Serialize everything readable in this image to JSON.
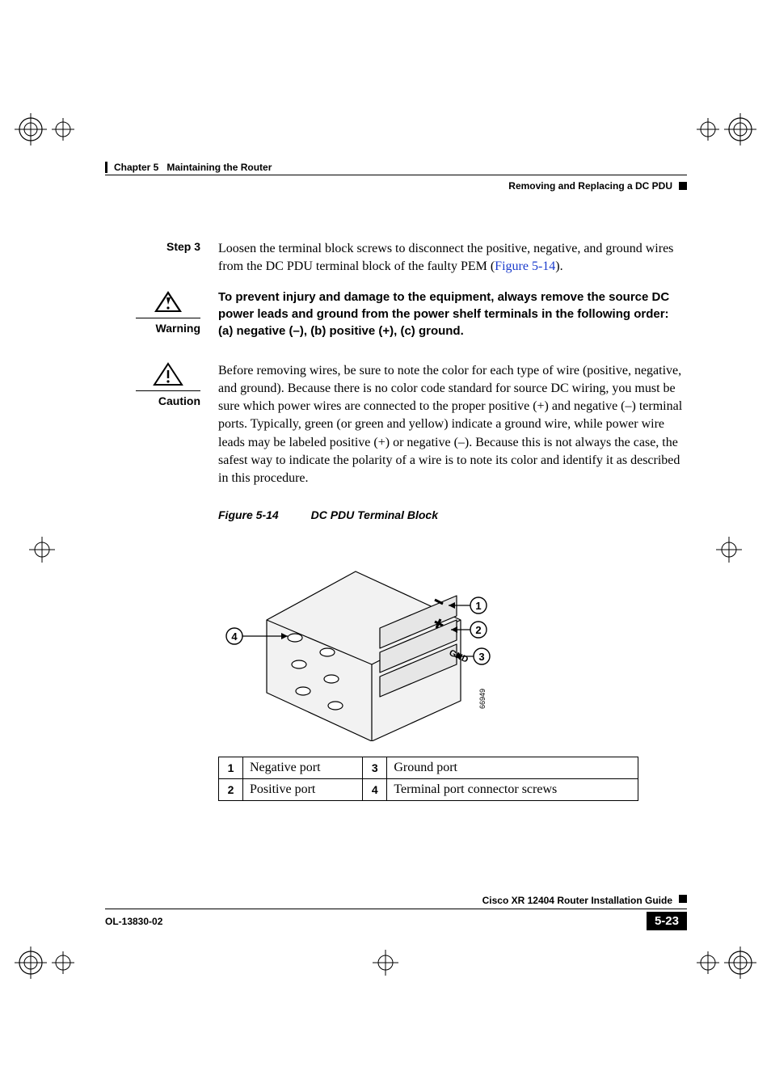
{
  "header": {
    "chapter": "Chapter 5",
    "chapter_title": "Maintaining the Router",
    "section": "Removing and Replacing a DC PDU"
  },
  "step": {
    "label": "Step 3",
    "text_a": "Loosen the terminal block screws to disconnect the positive, negative, and ground wires from the DC PDU terminal block of the faulty PEM (",
    "link": "Figure 5-14",
    "text_b": ")."
  },
  "warning": {
    "label": "Warning",
    "text": "To prevent injury and damage to the equipment, always remove the source DC power leads and ground from the power shelf terminals in the following order: (a) negative (–), (b) positive (+), (c) ground."
  },
  "caution": {
    "label": "Caution",
    "text": "Before removing wires, be sure to note the color for each type of wire (positive, negative, and ground). Because there is no color code standard for source DC wiring, you must be sure which power wires are connected to the proper positive (+) and negative (–) terminal ports. Typically, green (or green and yellow) indicate a ground wire, while power wire leads may be labeled positive (+) or negative (–). Because this is not always the case, the safest way to indicate the polarity of a wire is to note its color and identify it as described in this procedure."
  },
  "figure": {
    "number": "Figure 5-14",
    "title": "DC PDU Terminal Block",
    "art_id": "66949",
    "callouts": [
      "1",
      "2",
      "3",
      "4"
    ],
    "gnd_label": "GND"
  },
  "legend": [
    {
      "n": "1",
      "label": "Negative port"
    },
    {
      "n": "2",
      "label": "Positive port"
    },
    {
      "n": "3",
      "label": "Ground port"
    },
    {
      "n": "4",
      "label": "Terminal port connector screws"
    }
  ],
  "footer": {
    "book_title": "Cisco XR 12404 Router Installation Guide",
    "doc_id": "OL-13830-02",
    "page": "5-23"
  }
}
